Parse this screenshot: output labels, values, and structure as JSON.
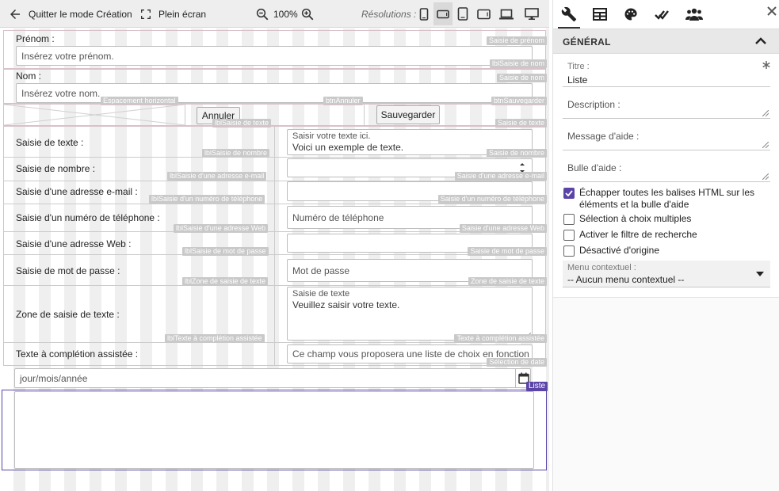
{
  "toolbar": {
    "quit_label": "Quitter le mode Création",
    "fullscreen_label": "Plein écran",
    "zoom_value": "100%",
    "resolutions_label": "Résolutions :"
  },
  "form": {
    "prenom_label": "Prénom :",
    "prenom_placeholder": "Insérez votre prénom.",
    "nom_label": "Nom :",
    "nom_placeholder": "Insérez votre nom.",
    "cancel_label": "Annuler",
    "save_label": "Sauvegarder",
    "text_label": "Saisie de texte :",
    "text_stack_label": "Saisir votre texte ici.",
    "text_value": "Voici un exemple de texte.",
    "number_label": "Saisie de nombre :",
    "email_label": "Saisie d'une adresse e-mail :",
    "phone_label": "Saisie d'un numéro de téléphone :",
    "phone_placeholder": "Numéro de téléphone",
    "web_label": "Saisie d'une adresse Web :",
    "password_label": "Saisie de mot de passe :",
    "password_placeholder": "Mot de passe",
    "textarea_label": "Zone de saisie de texte :",
    "textarea_stack_label": "Saisie de texte",
    "textarea_value": "Veuillez saisir votre texte.",
    "autocomplete_label": "Texte à complétion assistée :",
    "autocomplete_placeholder": "Ce champ vous proposera une liste de choix en fonction",
    "date_placeholder": "jour/mois/année"
  },
  "tags": {
    "saisie_prenom": "Saisie de prénom",
    "lbl_saisie_nom": "lblSaisie de nom",
    "saisie_nom": "Saisie de nom",
    "espacement": "Espacement horizontal",
    "btn_annuler": "btnAnnuler",
    "btn_sauvegarder": "btnSauvegarder",
    "lbl_saisie_texte": "lblSaisie de texte",
    "saisie_texte": "Saisie de texte",
    "lbl_saisie_nombre": "lblSaisie de nombre",
    "saisie_nombre": "Saisie de nombre",
    "lbl_saisie_email": "lblSaisie d'une adresse e-mail",
    "saisie_email": "Saisie d'une adresse e-mail",
    "lbl_saisie_tel": "lblSaisie d'un numéro de téléphone",
    "saisie_tel": "Saisie d'un numéro de téléphone",
    "lbl_saisie_web": "lblSaisie d'une adresse Web",
    "saisie_web": "Saisie d'une adresse Web",
    "lbl_saisie_mdp": "lblSaisie de mot de passe",
    "saisie_mdp": "Saisie de mot de passe",
    "lbl_zone": "lblZone de saisie de texte",
    "zone": "Zone de saisie de texte",
    "lbl_completion": "lblTexte à complétion assistée",
    "completion": "Texte à complétion assistée",
    "selection_date": "Sélection de date",
    "liste": "Liste"
  },
  "panel": {
    "section_title": "GÉNÉRAL",
    "titre_label": "Titre :",
    "titre_value": "Liste",
    "description_label": "Description :",
    "aide_label": "Message d'aide :",
    "bulle_label": "Bulle d'aide :",
    "checkboxes": [
      {
        "label": "Échapper toutes les balises HTML sur les éléments et la bulle d'aide",
        "checked": true
      },
      {
        "label": "Sélection à choix multiples",
        "checked": false
      },
      {
        "label": "Activer le filtre de recherche",
        "checked": false
      },
      {
        "label": "Désactivé d'origine",
        "checked": false
      }
    ],
    "menu_label": "Menu contextuel :",
    "menu_value": "-- Aucun menu contextuel --"
  },
  "colors": {
    "accent": "#5b44a8",
    "tag_bg": "#c9c9c9"
  }
}
